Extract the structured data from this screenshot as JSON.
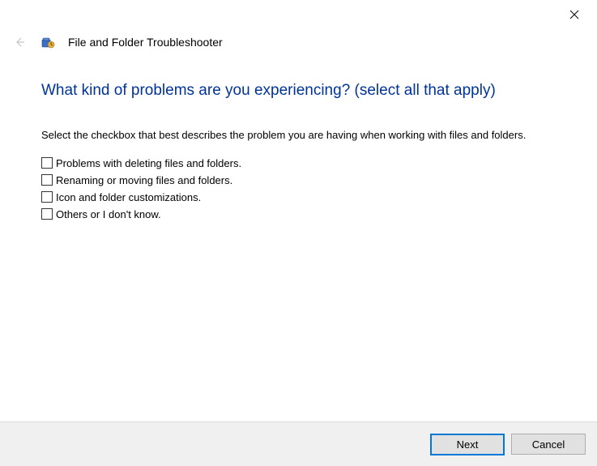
{
  "window": {
    "title": "File and Folder Troubleshooter"
  },
  "page": {
    "heading": "What kind of problems are you experiencing? (select all that apply)",
    "instruction": "Select the checkbox that best describes the problem you are having when working with files and folders."
  },
  "options": [
    {
      "label": "Problems with deleting files and folders.",
      "checked": false
    },
    {
      "label": "Renaming or moving files and folders.",
      "checked": false
    },
    {
      "label": "Icon and folder customizations.",
      "checked": false
    },
    {
      "label": "Others or I don't know.",
      "checked": false
    }
  ],
  "buttons": {
    "next": "Next",
    "cancel": "Cancel"
  }
}
